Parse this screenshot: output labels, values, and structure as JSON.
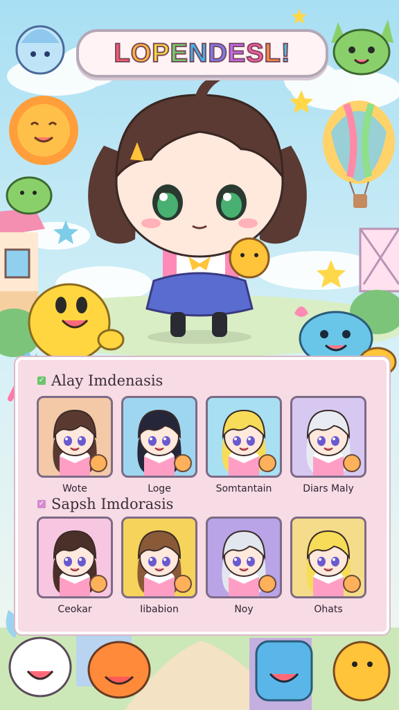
{
  "title": "LOPENDESL!",
  "title_letter_colors": [
    "#ff5a6e",
    "#ffb43a",
    "#f6d83a",
    "#6fd06a",
    "#39b5f0",
    "#7c7cf0",
    "#c46af0",
    "#ff5aa0",
    "#ff8a3a",
    "#4ac0e0"
  ],
  "sections": [
    {
      "title": "Alay Imdenasis",
      "check_icon": "check-icon",
      "check_color": "#6cc46c",
      "characters": [
        {
          "name": "Wote",
          "bg": "#f3c9a8",
          "hair": "#5a3a30",
          "accessory": "veggie-icon"
        },
        {
          "name": "Loge",
          "bg": "#9fd6ef",
          "hair": "#25263a",
          "accessory": "badge-icon"
        },
        {
          "name": "Somtantain",
          "bg": "#a8dff2",
          "hair": "#f6dc58",
          "accessory": "badge-icon"
        },
        {
          "name": "Diars Maly",
          "bg": "#d6c8f0",
          "hair": "#e8ecf2",
          "accessory": "star-icon"
        }
      ]
    },
    {
      "title": "Sapsh Imdorasis",
      "check_icon": "check-icon",
      "check_color": "#d68ad0",
      "characters": [
        {
          "name": "Ceokar",
          "bg": "#f7c6e0",
          "hair": "#4a3028",
          "accessory": "chick-icon"
        },
        {
          "name": "Iibabion",
          "bg": "#f6d35a",
          "hair": "#8a5a38",
          "accessory": "cookie-icon"
        },
        {
          "name": "Noy",
          "bg": "#b8a4e6",
          "hair": "#e2e6ee",
          "accessory": "cookie-icon"
        },
        {
          "name": "Ohats",
          "bg": "#f4dc8a",
          "hair": "#f6dc58",
          "accessory": "cookie-icon"
        }
      ]
    }
  ]
}
